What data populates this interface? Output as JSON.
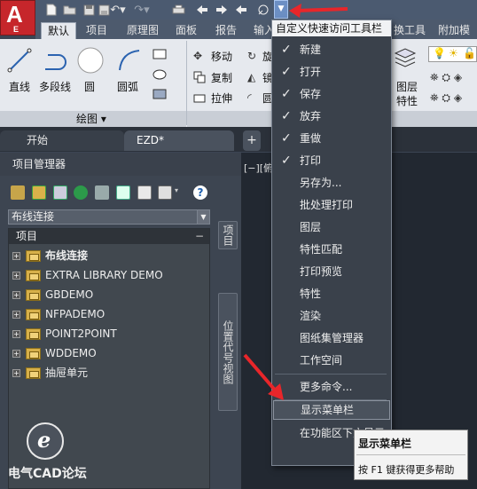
{
  "quick_access_toolbar": {
    "icons": [
      "new-icon",
      "open-icon",
      "save-icon",
      "save-as-icon",
      "undo-icon",
      "redo-icon",
      "print-icon",
      "back-icon",
      "forward-icon",
      "share-icon"
    ],
    "dropdown_arrow": "▼"
  },
  "app_button": {
    "letter": "A",
    "sub": "E",
    "color": "#c6262b"
  },
  "ribbon_tabs": [
    "默认",
    "项目",
    "原理图",
    "面板",
    "报告",
    "输入",
    "换工具",
    "附加模块"
  ],
  "ribbon": {
    "draw_tools": [
      "直线",
      "多段线",
      "圆",
      "圆弧"
    ],
    "modify_tools": [
      "移动",
      "复制",
      "拉伸"
    ],
    "modify_tools_partial": [
      "旋",
      "镜",
      "圆"
    ],
    "layer_tools": [
      "图层",
      "特性"
    ],
    "draw_panel_label": "绘图 ▾"
  },
  "doc_tabs": {
    "start": "开始",
    "current": "EZD*",
    "add": "+"
  },
  "canvas": {
    "view_label": "[−][俯视"
  },
  "project_manager": {
    "title": "项目管理器",
    "combo_value": "布线连接",
    "tree_header": "项目",
    "tree_header_toggle": "−",
    "items": [
      "布线连接",
      "EXTRA LIBRARY DEMO",
      "GBDEMO",
      "NFPADEMO",
      "POINT2POINT",
      "WDDEMO",
      "抽屉单元"
    ],
    "side_tab_project": "项目",
    "side_tab_location": "位置代号视图"
  },
  "customize_menu": {
    "title": "自定义快速访问工具栏",
    "items": [
      {
        "label": "新建",
        "checked": true
      },
      {
        "label": "打开",
        "checked": true
      },
      {
        "label": "保存",
        "checked": true
      },
      {
        "label": "放弃",
        "checked": true
      },
      {
        "label": "重做",
        "checked": true
      },
      {
        "label": "打印",
        "checked": true
      },
      {
        "label": "另存为...",
        "checked": false
      },
      {
        "label": "批处理打印",
        "checked": false
      },
      {
        "label": "图层",
        "checked": false
      },
      {
        "label": "特性匹配",
        "checked": false
      },
      {
        "label": "打印预览",
        "checked": false
      },
      {
        "label": "特性",
        "checked": false
      },
      {
        "label": "渲染",
        "checked": false
      },
      {
        "label": "图纸集管理器",
        "checked": false
      },
      {
        "label": "工作空间",
        "checked": false
      },
      {
        "label": "更多命令...",
        "checked": false
      },
      {
        "label": "显示菜单栏",
        "checked": false
      },
      {
        "label": "在功能区下方显示",
        "checked": false
      }
    ],
    "checkmark": "✓"
  },
  "tooltip": {
    "title": "显示菜单栏",
    "hint": "按 F1 键获得更多帮助"
  },
  "watermark": {
    "text": "电气CAD论坛",
    "logo": "e"
  },
  "accent_red": "#e8262a"
}
